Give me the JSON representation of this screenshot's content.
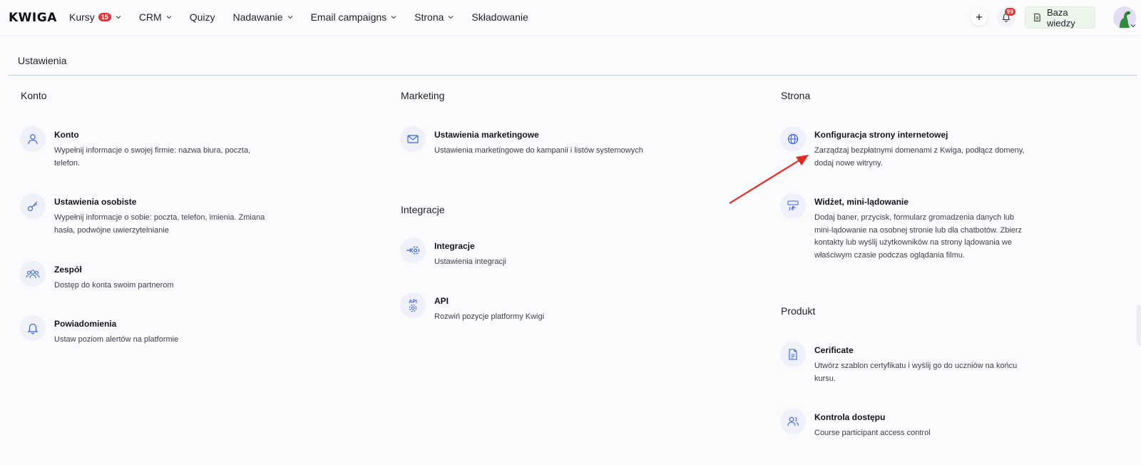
{
  "app": {
    "logo": "KWIGA"
  },
  "nav": {
    "items": [
      {
        "label": "Kursy",
        "badge": "15",
        "dropdown": true
      },
      {
        "label": "CRM",
        "dropdown": true
      },
      {
        "label": "Quizy",
        "dropdown": false
      },
      {
        "label": "Nadawanie",
        "dropdown": true
      },
      {
        "label": "Email campaigns",
        "dropdown": true
      },
      {
        "label": "Strona",
        "dropdown": true
      },
      {
        "label": "Składowanie",
        "dropdown": false
      }
    ],
    "notifications_badge": "99",
    "knowledge_base_label": "Baza wiedzy"
  },
  "page": {
    "title": "Ustawienia"
  },
  "sections": {
    "konto": {
      "title": "Konto",
      "items": [
        {
          "title": "Konto",
          "desc": "Wypełnij informacje o swojej firmie: nazwa biura, poczta, telefon.",
          "icon": "user-icon"
        },
        {
          "title": "Ustawienia osobiste",
          "desc": "Wypełnij informacje o sobie: poczta, telefon, imienia. Zmiana hasła, podwójne uwierzytelnianie",
          "icon": "key-icon"
        },
        {
          "title": "Zespół",
          "desc": "Dostęp do konta swoim partnerom",
          "icon": "team-icon"
        },
        {
          "title": "Powiadomienia",
          "desc": "Ustaw poziom alertów na platformie",
          "icon": "bell-icon"
        }
      ]
    },
    "marketing": {
      "title": "Marketing",
      "items": [
        {
          "title": "Ustawienia marketingowe",
          "desc": "Ustawienia marketingowe do kampanii i listów systemowych",
          "icon": "mail-icon"
        }
      ]
    },
    "integracje": {
      "title": "Integracje",
      "items": [
        {
          "title": "Integracje",
          "desc": "Ustawienia integracji",
          "icon": "integration-icon"
        },
        {
          "title": "API",
          "desc": "Rozwiń pozycje platformy Kwigi",
          "icon": "api-icon",
          "icon_text": "API"
        }
      ]
    },
    "strona": {
      "title": "Strona",
      "items": [
        {
          "title": "Konfiguracja strony internetowej",
          "desc": "Zarządzaj bezpłatnymi domenami z Kwiga, podłącz domeny, dodaj nowe witryny.",
          "icon": "globe-icon"
        },
        {
          "title": "Widżet, mini-lądowanie",
          "desc": "Dodaj baner, przycisk, formularz gromadzenia danych lub mini-lądowanie na osobnej stronie lub dla chatbotów. Zbierz kontakty lub wyślij użytkowników na strony lądowania we właściwym czasie podczas oglądania filmu.",
          "icon": "widget-icon"
        }
      ]
    },
    "produkt": {
      "title": "Produkt",
      "items": [
        {
          "title": "Cerificate",
          "desc": "Utwórz szablon certyfikatu i wyślij go do uczniów na końcu kursu.",
          "icon": "certificate-icon"
        },
        {
          "title": "Kontrola dostępu",
          "desc": "Course participant access control",
          "icon": "access-control-icon"
        }
      ]
    }
  },
  "colors": {
    "accent": "#3b63d9",
    "badge": "#e3343a",
    "annotation_arrow": "#e8281f",
    "kb_button_bg": "#eaf7ea"
  }
}
